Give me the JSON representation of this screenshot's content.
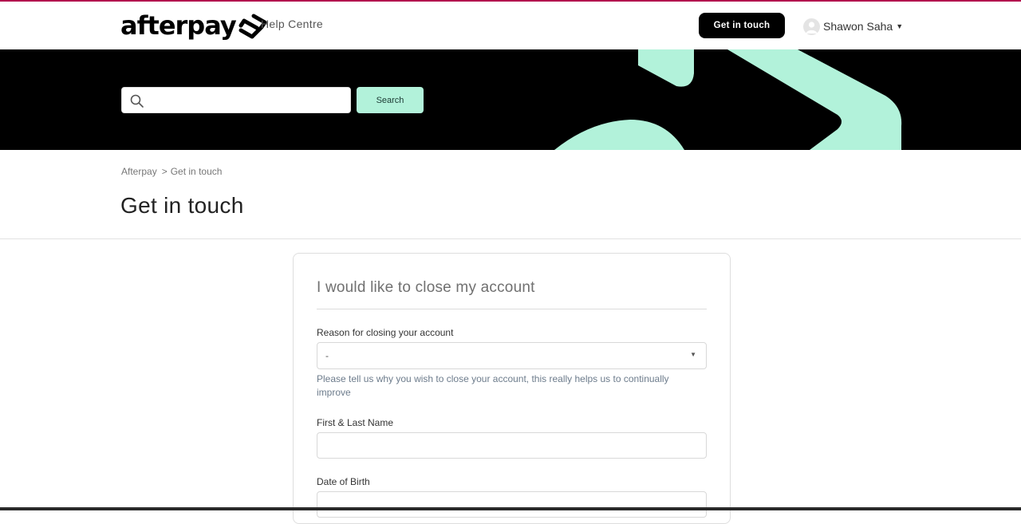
{
  "colors": {
    "accent_top_line": "#b3124e",
    "brand_mint": "#b2f2da",
    "hero_background": "#000000",
    "primary_button": "#000000"
  },
  "header": {
    "logo_text": "afterpay",
    "logo_icon": "afterpay-arrows-icon",
    "help_centre": "Help Centre",
    "get_in_touch_label": "Get in touch",
    "user_name": "Shawon Saha",
    "user_menu_icon": "chevron-down-icon"
  },
  "hero": {
    "search_placeholder": "",
    "search_icon": "search-icon",
    "search_button_label": "Search"
  },
  "breadcrumb": {
    "items": [
      "Afterpay",
      "Get in touch"
    ],
    "separator": ">"
  },
  "page_title": "Get in touch",
  "form": {
    "title": "I would like to close my account",
    "reason": {
      "label": "Reason for closing your account",
      "value": "-",
      "hint": "Please tell us why you wish to close your account, this really helps us to continually improve"
    },
    "name": {
      "label": "First & Last Name",
      "value": ""
    },
    "dob": {
      "label": "Date of Birth",
      "value": ""
    }
  }
}
